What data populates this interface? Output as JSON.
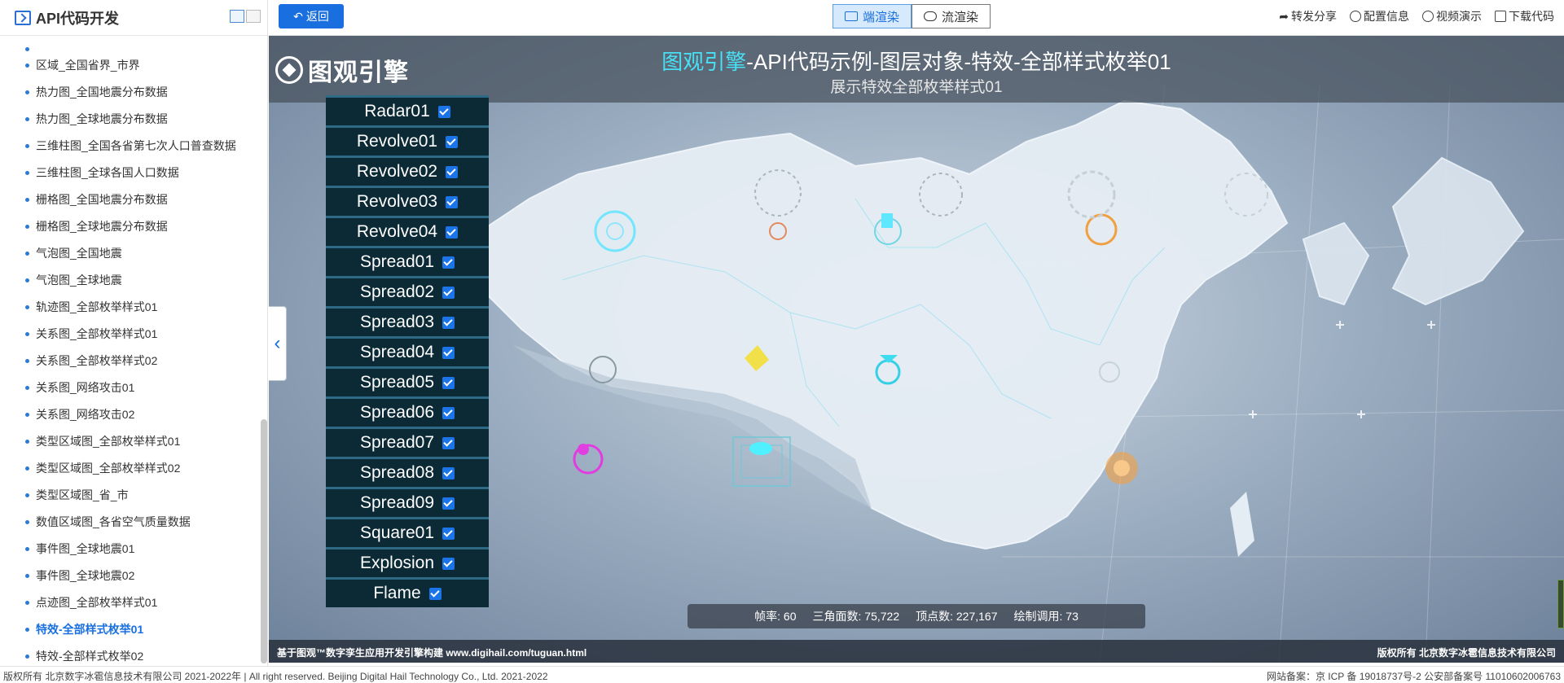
{
  "sidebar": {
    "title": "API代码开发",
    "items": [
      {
        "label": "区域_全国省界_市界"
      },
      {
        "label": "热力图_全国地震分布数据"
      },
      {
        "label": "热力图_全球地震分布数据"
      },
      {
        "label": "三维柱图_全国各省第七次人口普查数据"
      },
      {
        "label": "三维柱图_全球各国人口数据"
      },
      {
        "label": "栅格图_全国地震分布数据"
      },
      {
        "label": "栅格图_全球地震分布数据"
      },
      {
        "label": "气泡图_全国地震"
      },
      {
        "label": "气泡图_全球地震"
      },
      {
        "label": "轨迹图_全部枚举样式01"
      },
      {
        "label": "关系图_全部枚举样式01"
      },
      {
        "label": "关系图_全部枚举样式02"
      },
      {
        "label": "关系图_网络攻击01"
      },
      {
        "label": "关系图_网络攻击02"
      },
      {
        "label": "类型区域图_全部枚举样式01"
      },
      {
        "label": "类型区域图_全部枚举样式02"
      },
      {
        "label": "类型区域图_省_市"
      },
      {
        "label": "数值区域图_各省空气质量数据"
      },
      {
        "label": "事件图_全球地震01"
      },
      {
        "label": "事件图_全球地震02"
      },
      {
        "label": "点迹图_全部枚举样式01"
      },
      {
        "label": "特效-全部样式枚举01",
        "active": true
      },
      {
        "label": "特效-全部样式枚举02"
      }
    ]
  },
  "toolbar": {
    "back_label": "返回",
    "render_client": "端渲染",
    "render_stream": "流渲染",
    "share": "转发分享",
    "config": "配置信息",
    "video": "视频演示",
    "download": "下载代码"
  },
  "viewer": {
    "brand": "图观引擎",
    "title_highlight": "图观引擎",
    "title_rest": "-API代码示例-图层对象-特效-全部样式枚举01",
    "subtitle": "展示特效全部枚举样式01",
    "effects": [
      {
        "label": "Radar01",
        "checked": true
      },
      {
        "label": "Revolve01",
        "checked": true
      },
      {
        "label": "Revolve02",
        "checked": true
      },
      {
        "label": "Revolve03",
        "checked": true
      },
      {
        "label": "Revolve04",
        "checked": true
      },
      {
        "label": "Spread01",
        "checked": true
      },
      {
        "label": "Spread02",
        "checked": true
      },
      {
        "label": "Spread03",
        "checked": true
      },
      {
        "label": "Spread04",
        "checked": true
      },
      {
        "label": "Spread05",
        "checked": true
      },
      {
        "label": "Spread06",
        "checked": true
      },
      {
        "label": "Spread07",
        "checked": true
      },
      {
        "label": "Spread08",
        "checked": true
      },
      {
        "label": "Spread09",
        "checked": true
      },
      {
        "label": "Square01",
        "checked": true
      },
      {
        "label": "Explosion",
        "checked": true
      },
      {
        "label": "Flame",
        "checked": true
      }
    ],
    "stats": {
      "fps_label": "帧率:",
      "fps": "60",
      "tri_label": "三角面数:",
      "tri": "75,722",
      "vert_label": "顶点数:",
      "vert": "227,167",
      "draw_label": "绘制调用:",
      "draw": "73"
    },
    "footer_left": "基于图观™数字孪生应用开发引擎构建 www.digihail.com/tuguan.html",
    "footer_right": "版权所有 北京数字冰雹信息技术有限公司",
    "colors": {
      "accent": "#1a6fe0",
      "title_highlight": "#47e0f5",
      "panel": "#0b2a36"
    }
  },
  "bottom": {
    "left": "版权所有 北京数字冰雹信息技术有限公司 2021-2022年 | All right reserved. Beijing Digital Hail Technology Co., Ltd. 2021-2022",
    "right": "网站备案：京 ICP 备 19018737号-2 公安部备案号 11010602006763"
  }
}
